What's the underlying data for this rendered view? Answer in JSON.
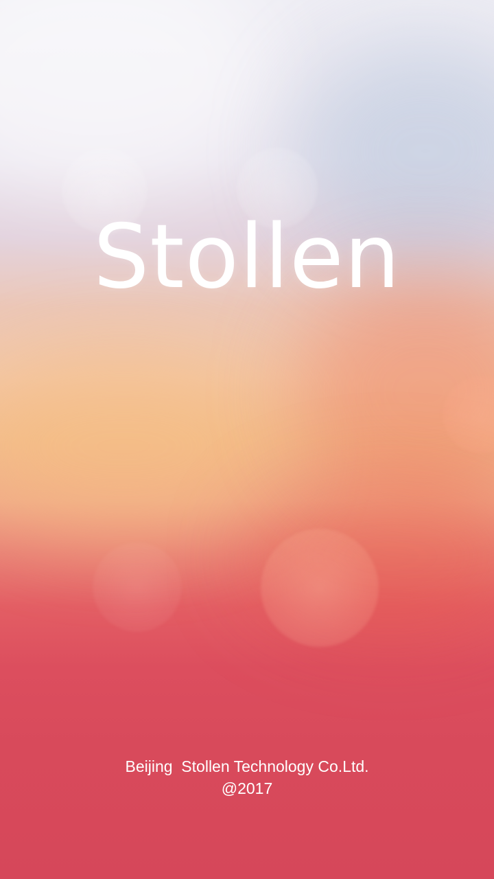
{
  "splash": {
    "brand_name": "Stollen",
    "company_line": "Beijing  Stollen Technology Co.Ltd.",
    "copyright_line": "@2017"
  },
  "colors": {
    "top": "#eeedf4",
    "middle": "#f2bd8f",
    "bottom": "#d6475a",
    "text": "#ffffff"
  }
}
